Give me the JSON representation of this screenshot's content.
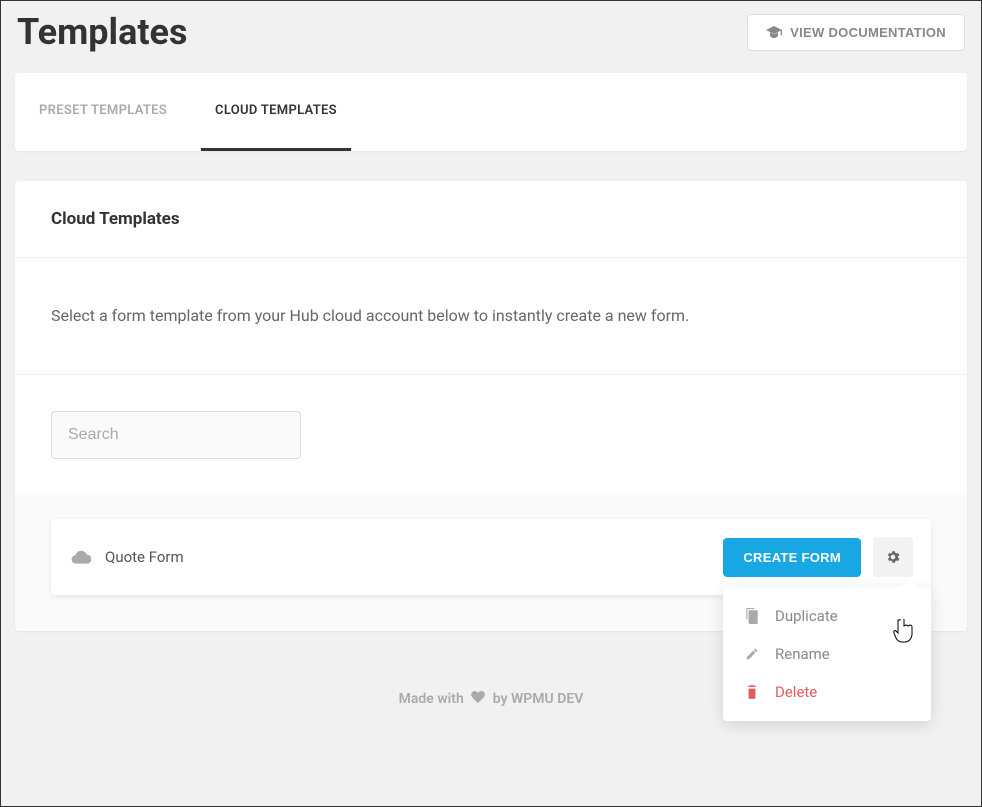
{
  "header": {
    "title": "Templates",
    "doc_button": "VIEW DOCUMENTATION"
  },
  "tabs": {
    "preset": "PRESET TEMPLATES",
    "cloud": "CLOUD TEMPLATES"
  },
  "section": {
    "title": "Cloud Templates",
    "description": "Select a form template from your Hub cloud account below to instantly create a new form."
  },
  "search": {
    "placeholder": "Search"
  },
  "template": {
    "name": "Quote Form",
    "create_button": "CREATE FORM"
  },
  "dropdown": {
    "duplicate": "Duplicate",
    "rename": "Rename",
    "delete": "Delete"
  },
  "footer": {
    "made_with": "Made with",
    "by": "by WPMU DEV"
  }
}
